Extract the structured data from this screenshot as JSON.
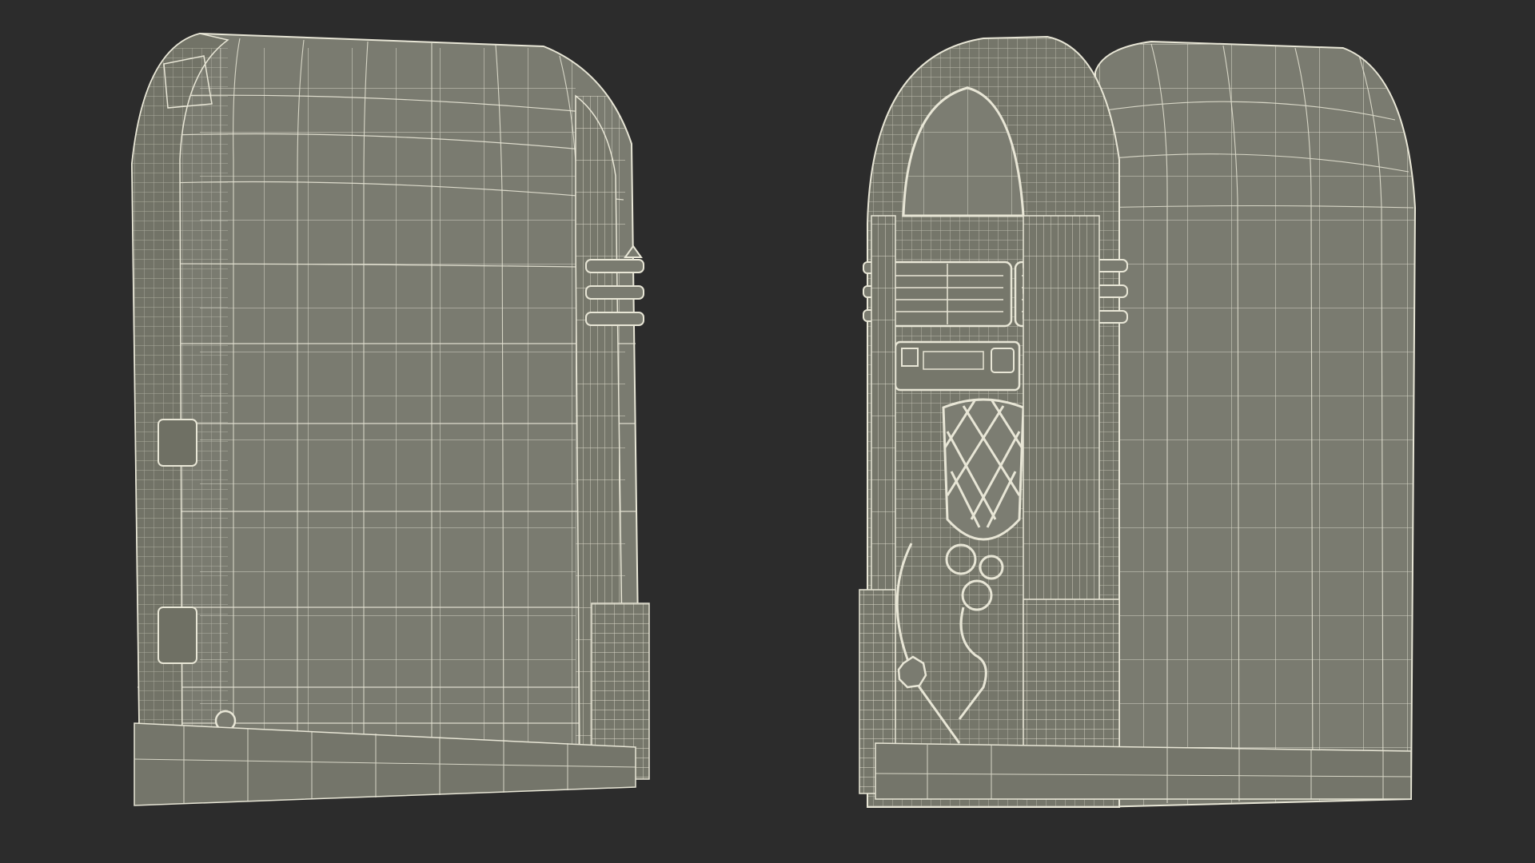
{
  "scene": {
    "background_color": "#2c2c2c",
    "surface_color": "#7a7b70",
    "wire_color": "#e8e6d6",
    "objects": [
      {
        "name": "jukebox-side-back-view"
      },
      {
        "name": "jukebox-front-three-quarter-view"
      }
    ]
  }
}
